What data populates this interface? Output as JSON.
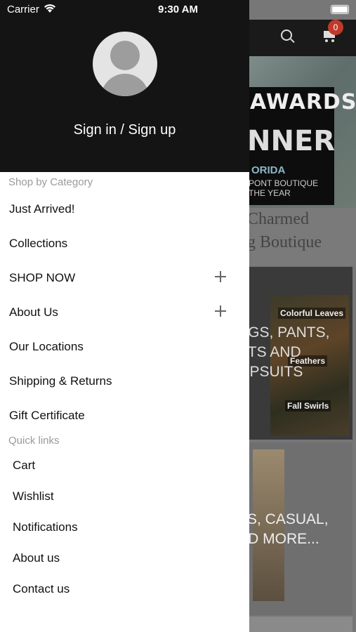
{
  "status_bar": {
    "carrier": "Carrier",
    "time": "9:30 AM"
  },
  "background": {
    "cart_count": "0",
    "banner": {
      "line1": "AWARDS",
      "line2": "NNER",
      "line3": "ORIDA",
      "line4": "PONT BOUTIQUE",
      "line5": "THE YEAR"
    },
    "shop_name": [
      "Charmed",
      "g Boutique"
    ],
    "panel1": {
      "text": [
        "NGS, PANTS,",
        "RTS AND",
        "MPSUITS"
      ],
      "tags": [
        "Colorful Leaves",
        "Feathers",
        "Fall Swirls"
      ]
    },
    "panel2": {
      "text": [
        "ES, CASUAL,",
        "ND MORE..."
      ]
    }
  },
  "drawer": {
    "sign_in_label": "Sign in / Sign up",
    "shop_section_title": "Shop by Category",
    "categories": [
      {
        "label": "Just Arrived!",
        "expandable": false
      },
      {
        "label": "Collections",
        "expandable": false
      },
      {
        "label": "SHOP NOW",
        "expandable": true
      },
      {
        "label": "About Us",
        "expandable": true
      },
      {
        "label": "Our Locations",
        "expandable": false
      },
      {
        "label": "Shipping & Returns",
        "expandable": false
      },
      {
        "label": "Gift Certificate",
        "expandable": false
      }
    ],
    "quick_section_title": "Quick links",
    "quick_links": [
      "Cart",
      "Wishlist",
      "Notifications",
      "About us",
      "Contact us"
    ]
  },
  "colors": {
    "drawer_header": "#141414",
    "badge": "#c0392b",
    "section_text": "#9a9a9a"
  }
}
